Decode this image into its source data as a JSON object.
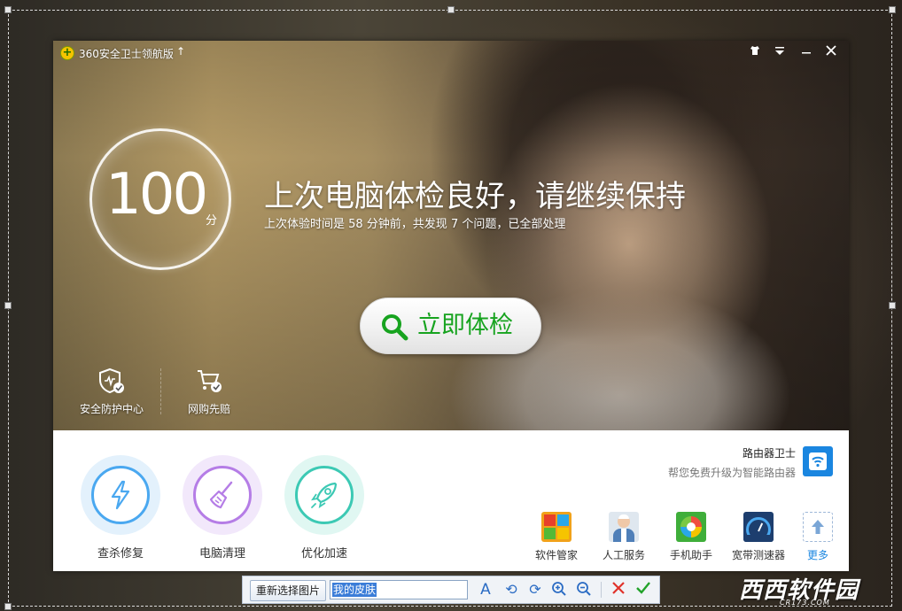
{
  "window": {
    "title": "360安全卫士领航版",
    "title_arrow": "↑",
    "controls": {
      "skin": "⬆",
      "menu": "≡",
      "minimize": "—",
      "close": "✕"
    }
  },
  "score": {
    "value": "100",
    "unit": "分"
  },
  "status": {
    "headline": "上次电脑体检良好，请继续保持",
    "detail": "上次体验时间是 58 分钟前，共发现 7 个问题，已全部处理"
  },
  "scan_button": {
    "label": "立即体检",
    "icon": "search-icon"
  },
  "shortcuts": [
    {
      "label": "安全防护中心",
      "icon": "shield-check-icon"
    },
    {
      "label": "网购先赔",
      "icon": "cart-check-icon"
    }
  ],
  "tools": [
    {
      "label": "查杀修复",
      "icon": "lightning-icon",
      "color": "#4aa8f0"
    },
    {
      "label": "电脑清理",
      "icon": "broom-icon",
      "color": "#b57de6"
    },
    {
      "label": "优化加速",
      "icon": "rocket-icon",
      "color": "#3cc9b4"
    }
  ],
  "router_promo": {
    "title": "路由器卫士",
    "desc": "帮您免费升级为智能路由器",
    "icon": "wifi-icon"
  },
  "apps": [
    {
      "label": "软件管家",
      "icon": "software-manager-icon"
    },
    {
      "label": "人工服务",
      "icon": "support-agent-icon"
    },
    {
      "label": "手机助手",
      "icon": "phone-assistant-icon"
    },
    {
      "label": "宽带测速器",
      "icon": "speedometer-icon"
    },
    {
      "label": "更多",
      "icon": "upload-arrow-icon"
    }
  ],
  "skin_toolbar": {
    "reselect_label": "重新选择图片",
    "skin_name": "我的皮肤",
    "icons": [
      "text-icon",
      "rotate-left-icon",
      "rotate-right-icon",
      "zoom-in-icon",
      "zoom-out-icon",
      "cancel-icon",
      "confirm-icon"
    ]
  },
  "watermark": {
    "text": "西西软件园",
    "sub": "CR173.COM"
  },
  "colors": {
    "accent_green": "#17a31f",
    "link_blue": "#1a86e0"
  }
}
